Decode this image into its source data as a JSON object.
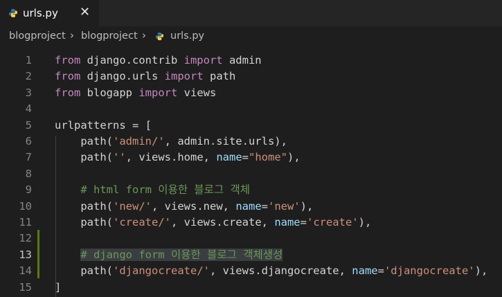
{
  "tab": {
    "label": "urls.py",
    "close": "✕"
  },
  "breadcrumb": [
    "blogproject",
    "blogproject",
    "urls.py"
  ],
  "colors": {
    "python_blue": "#3572a5",
    "python_yellow": "#ffd43b",
    "modified_bar": "#587c0c"
  },
  "lines": [
    {
      "n": "1",
      "tokens": [
        [
          "kw",
          "from"
        ],
        [
          "t",
          " django.contrib "
        ],
        [
          "kw",
          "import"
        ],
        [
          "t",
          " admin"
        ]
      ]
    },
    {
      "n": "2",
      "tokens": [
        [
          "kw",
          "from"
        ],
        [
          "t",
          " django.urls "
        ],
        [
          "kw",
          "import"
        ],
        [
          "t",
          " path"
        ]
      ]
    },
    {
      "n": "3",
      "tokens": [
        [
          "kw",
          "from"
        ],
        [
          "t",
          " blogapp "
        ],
        [
          "kw",
          "import"
        ],
        [
          "t",
          " views"
        ]
      ]
    },
    {
      "n": "4",
      "tokens": []
    },
    {
      "n": "5",
      "tokens": [
        [
          "t",
          "urlpatterns = ["
        ]
      ]
    },
    {
      "n": "6",
      "tokens": [
        [
          "t",
          "    path("
        ],
        [
          "str",
          "'admin/'"
        ],
        [
          "t",
          ", admin.site.urls),"
        ]
      ]
    },
    {
      "n": "7",
      "tokens": [
        [
          "t",
          "    path("
        ],
        [
          "str",
          "''"
        ],
        [
          "t",
          ", views.home, "
        ],
        [
          "param",
          "name"
        ],
        [
          "t",
          "="
        ],
        [
          "str",
          "\"home\""
        ],
        [
          "t",
          "),"
        ]
      ]
    },
    {
      "n": "8",
      "tokens": []
    },
    {
      "n": "9",
      "tokens": [
        [
          "t",
          "    "
        ],
        [
          "com",
          "# html form 이용한 블로그 객체"
        ]
      ]
    },
    {
      "n": "10",
      "tokens": [
        [
          "t",
          "    path("
        ],
        [
          "str",
          "'new/'"
        ],
        [
          "t",
          ", views.new, "
        ],
        [
          "param",
          "name"
        ],
        [
          "t",
          "="
        ],
        [
          "str",
          "'new'"
        ],
        [
          "t",
          "),"
        ]
      ]
    },
    {
      "n": "11",
      "tokens": [
        [
          "t",
          "    path("
        ],
        [
          "str",
          "'create/'"
        ],
        [
          "t",
          ", views.create, "
        ],
        [
          "param",
          "name"
        ],
        [
          "t",
          "="
        ],
        [
          "str",
          "'create'"
        ],
        [
          "t",
          "),"
        ]
      ]
    },
    {
      "n": "12",
      "tokens": []
    },
    {
      "n": "13",
      "tokens": [
        [
          "t",
          "    "
        ],
        [
          "comsel",
          "# django form 이용한 블로그 객체생성"
        ]
      ]
    },
    {
      "n": "14",
      "tokens": [
        [
          "t",
          "    path("
        ],
        [
          "str",
          "'djangocreate/'"
        ],
        [
          "t",
          ", views.djangocreate, "
        ],
        [
          "param",
          "name"
        ],
        [
          "t",
          "="
        ],
        [
          "str",
          "'djangocreate'"
        ],
        [
          "t",
          "),"
        ]
      ]
    },
    {
      "n": "15",
      "tokens": [
        [
          "t",
          "]"
        ]
      ]
    }
  ],
  "active_line": "13"
}
